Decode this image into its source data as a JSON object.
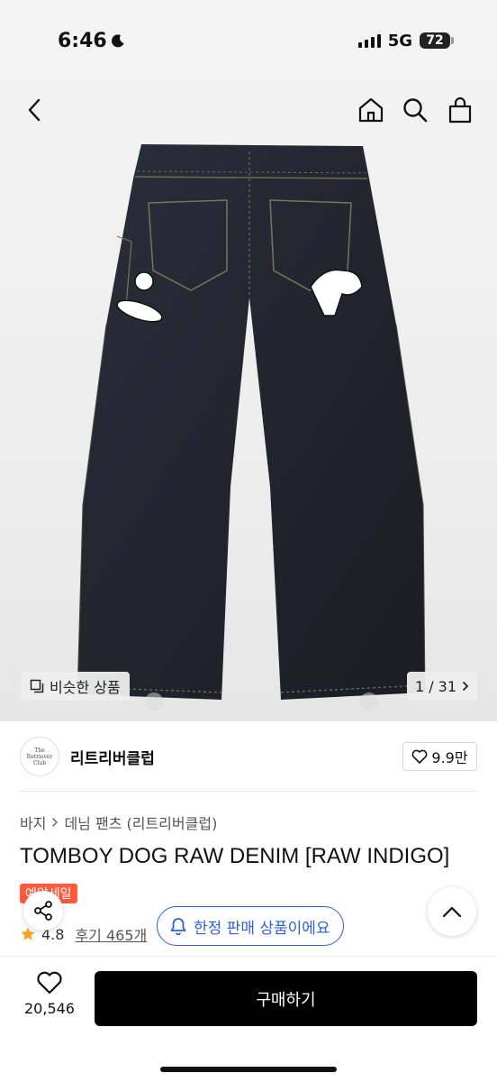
{
  "status_bar": {
    "time": "6:46",
    "network": "5G",
    "battery": "72"
  },
  "nav": {
    "back_icon": "chevron-left-icon",
    "home_icon": "home-icon",
    "search_icon": "search-icon",
    "cart_icon": "shopping-bag-icon"
  },
  "gallery": {
    "similar_label": "비슷한 상품",
    "counter": "1 / 31"
  },
  "brand": {
    "logo_line1": "The",
    "logo_line2": "Retriever",
    "logo_line3": "Club",
    "name": "리트리버클럽",
    "likes": "9.9만"
  },
  "breadcrumb": {
    "items": [
      "바지",
      "데님 팬츠 (리트리버클럽)"
    ]
  },
  "product": {
    "title": "TOMBOY DOG RAW DENIM [RAW INDIGO]",
    "sale_badge": "예약세일",
    "rating": "4.8",
    "reviews": "후기 465개"
  },
  "notice": {
    "label": "한정 판매 상품이에요"
  },
  "bottom": {
    "wish_count": "20,546",
    "buy_label": "구매하기"
  },
  "colors": {
    "accent_blue": "#2f5fd6",
    "sale_red": "#ff5a3c",
    "star": "#f5a623"
  }
}
